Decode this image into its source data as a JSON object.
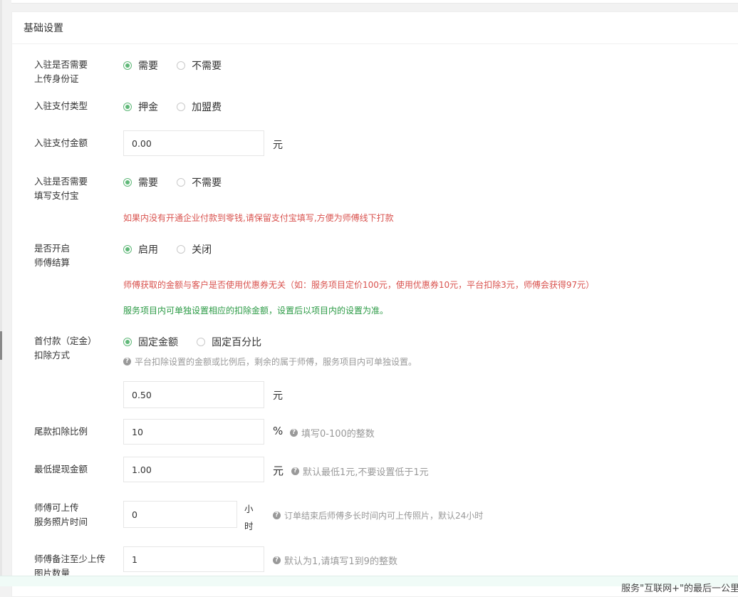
{
  "section": {
    "title": "基础设置"
  },
  "form": {
    "id_card": {
      "label_line1": "入驻是否需要",
      "label_line2": "上传身份证",
      "options": [
        "需要",
        "不需要"
      ],
      "selected": "需要"
    },
    "pay_type": {
      "label": "入驻支付类型",
      "options": [
        "押金",
        "加盟费"
      ],
      "selected": "押金"
    },
    "pay_amount": {
      "label": "入驻支付金额",
      "value": "0.00",
      "unit": "元"
    },
    "alipay": {
      "label_line1": "入驻是否需要",
      "label_line2": "填写支付宝",
      "options": [
        "需要",
        "不需要"
      ],
      "selected": "需要",
      "note": "如果内没有开通企业付款到零钱,请保留支付宝填写,方便为师傅线下打款"
    },
    "settlement": {
      "label_line1": "是否开启",
      "label_line2": "师傅结算",
      "options": [
        "启用",
        "关闭"
      ],
      "selected": "启用",
      "note_red": "师傅获取的金额与客户是否使用优惠券无关（如：服务项目定价100元，使用优惠券10元，平台扣除3元，师傅会获得97元）",
      "note_green": "服务项目内可单独设置相应的扣除金额，设置后以项目内的设置为准。"
    },
    "deposit_deduct": {
      "label_line1": "首付款（定金）",
      "label_line2": "扣除方式",
      "options": [
        "固定金额",
        "固定百分比"
      ],
      "selected": "固定金额",
      "hint": "平台扣除设置的金额或比例后，剩余的属于师傅，服务项目内可单独设置。",
      "value": "0.50",
      "unit": "元"
    },
    "tail_ratio": {
      "label": "尾款扣除比例",
      "value": "10",
      "unit": "%",
      "hint": "填写0-100的整数"
    },
    "min_withdraw": {
      "label": "最低提现金额",
      "value": "1.00",
      "unit": "元",
      "hint": "默认最低1元,不要设置低于1元"
    },
    "photo_time": {
      "label_line1": "师傅可上传",
      "label_line2": "服务照片时间",
      "value": "0",
      "unit_line1": "小",
      "unit_line2": "时",
      "hint": "订单结束后师傅多长时间内可上传照片，默认24小时"
    },
    "min_photos": {
      "label_line1": "师傅备注至少上传",
      "label_line2": "图片数量",
      "value": "1",
      "hint": "默认为1,请填写1到9的整数"
    }
  },
  "footer": {
    "text": "服务\"互联网+\"的最后一公里"
  },
  "colors": {
    "accent": "#5fb878",
    "note_red": "#d9534f",
    "note_green": "#2b9a45"
  }
}
